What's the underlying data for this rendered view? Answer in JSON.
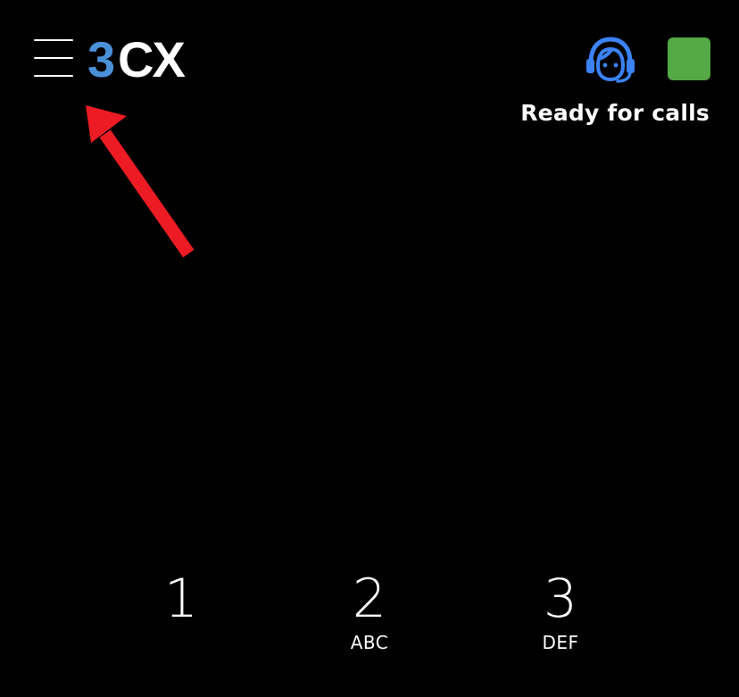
{
  "header": {
    "menu_icon": "hamburger-menu-icon",
    "logo": {
      "digit": "3",
      "letters": "CX",
      "digit_color": "#4a90d9",
      "letters_color": "#ffffff"
    },
    "agent_icon": "headset-icon",
    "agent_icon_color": "#3b82f6",
    "status_color": "#54a845",
    "status_text": "Ready for calls"
  },
  "annotation": {
    "arrow_color": "#ed1c24"
  },
  "keypad": {
    "keys": [
      {
        "digit": "1",
        "letters": ""
      },
      {
        "digit": "2",
        "letters": "ABC"
      },
      {
        "digit": "3",
        "letters": "DEF"
      }
    ]
  }
}
